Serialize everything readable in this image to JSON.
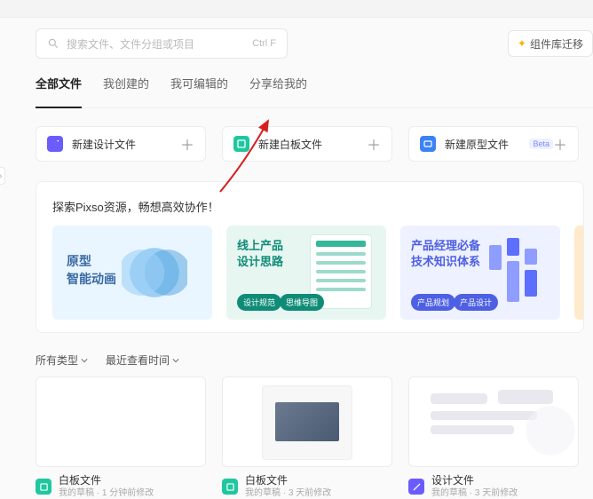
{
  "search": {
    "placeholder": "搜索文件、文件分组或项目",
    "shortcut": "Ctrl F"
  },
  "migrate_button": "组件库迁移",
  "tabs": [
    "全部文件",
    "我创建的",
    "我可编辑的",
    "分享给我的"
  ],
  "create": [
    {
      "label": "新建设计文件",
      "icon": "purple"
    },
    {
      "label": "新建白板文件",
      "icon": "teal"
    },
    {
      "label": "新建原型文件",
      "icon": "blue",
      "beta": "Beta"
    }
  ],
  "banner_title": "探索Pixso资源，畅想高效协作！",
  "resources": [
    {
      "line1": "原型",
      "line2": "智能动画"
    },
    {
      "line1": "线上产品",
      "line2": "设计思路",
      "tag1": "设计规范",
      "tag2": "思维导图"
    },
    {
      "line1": "产品经理必备",
      "line2": "技术知识体系",
      "tag1": "产品规划",
      "tag2": "产品设计"
    }
  ],
  "filters": {
    "type": "所有类型",
    "sort": "最近查看时间"
  },
  "files": [
    {
      "name": "白板文件",
      "sub": "我的草稿 · 1 分钟前修改",
      "icon": "teal",
      "thumb": "blank"
    },
    {
      "name": "白板文件",
      "sub": "我的草稿 · 3 天前修改",
      "icon": "teal",
      "thumb": "docimg"
    },
    {
      "name": "设计文件",
      "sub": "我的草稿 · 3 天前修改",
      "icon": "purple",
      "thumb": "abstract"
    }
  ]
}
